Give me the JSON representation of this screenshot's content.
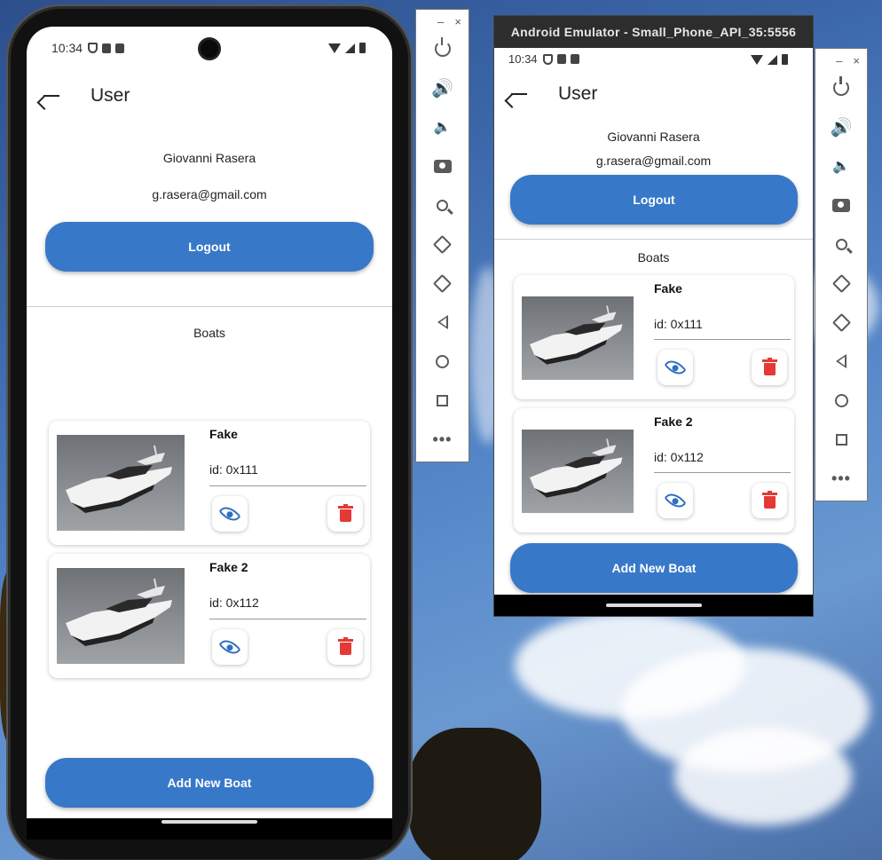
{
  "status": {
    "time": "10:34"
  },
  "user_page": {
    "title": "User",
    "name": "Giovanni Rasera",
    "email": "g.rasera@gmail.com",
    "logout_label": "Logout",
    "boats_header": "Boats",
    "add_boat_label": "Add New Boat",
    "boats": [
      {
        "name": "Fake",
        "id_label": "id: 0x111"
      },
      {
        "name": "Fake 2",
        "id_label": "id: 0x112"
      }
    ]
  },
  "emulator": {
    "window_title": "Android Emulator - Small_Phone_API_35:5556"
  },
  "toolbar": {
    "minimize": "–",
    "close": "×",
    "more": "•••",
    "items": [
      "power-icon",
      "volume-up-icon",
      "volume-down-icon",
      "camera-icon",
      "zoom-icon",
      "rotate-left-icon",
      "rotate-right-icon",
      "back-icon",
      "home-icon",
      "overview-icon",
      "more-icon"
    ]
  },
  "colors": {
    "accent": "#3878c8",
    "delete": "#e53935",
    "view": "#2f6fc0"
  }
}
